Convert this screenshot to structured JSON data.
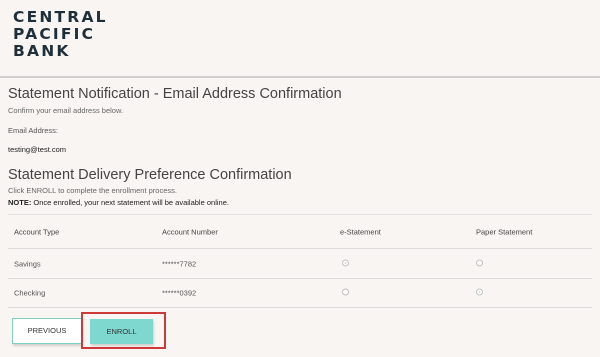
{
  "logo": {
    "line1": "CENTRAL",
    "line2": "PACIFIC",
    "line3": "BANK"
  },
  "email_section": {
    "title": "Statement Notification - Email Address Confirmation",
    "subtitle": "Confirm your email address below.",
    "label": "Email Address:",
    "value": "testing@test.com"
  },
  "delivery_section": {
    "title": "Statement Delivery Preference Confirmation",
    "instruction": "Click ENROLL to complete the enrollment process.",
    "note_label": "NOTE:",
    "note_text": " Once enrolled, your next statement will be available online."
  },
  "table": {
    "headers": [
      "Account Type",
      "Account Number",
      "e-Statement",
      "Paper Statement"
    ],
    "rows": [
      {
        "type": "Savings",
        "number": "******7782",
        "estatement": true,
        "paper": false
      },
      {
        "type": "Checking",
        "number": "******0392",
        "estatement": false,
        "paper": true
      }
    ]
  },
  "buttons": {
    "previous": "PREVIOUS",
    "enroll": "ENROLL"
  },
  "colors": {
    "accent": "#7fd8d0",
    "highlight": "#cc3a3a",
    "logo": "#1f2f3a"
  }
}
